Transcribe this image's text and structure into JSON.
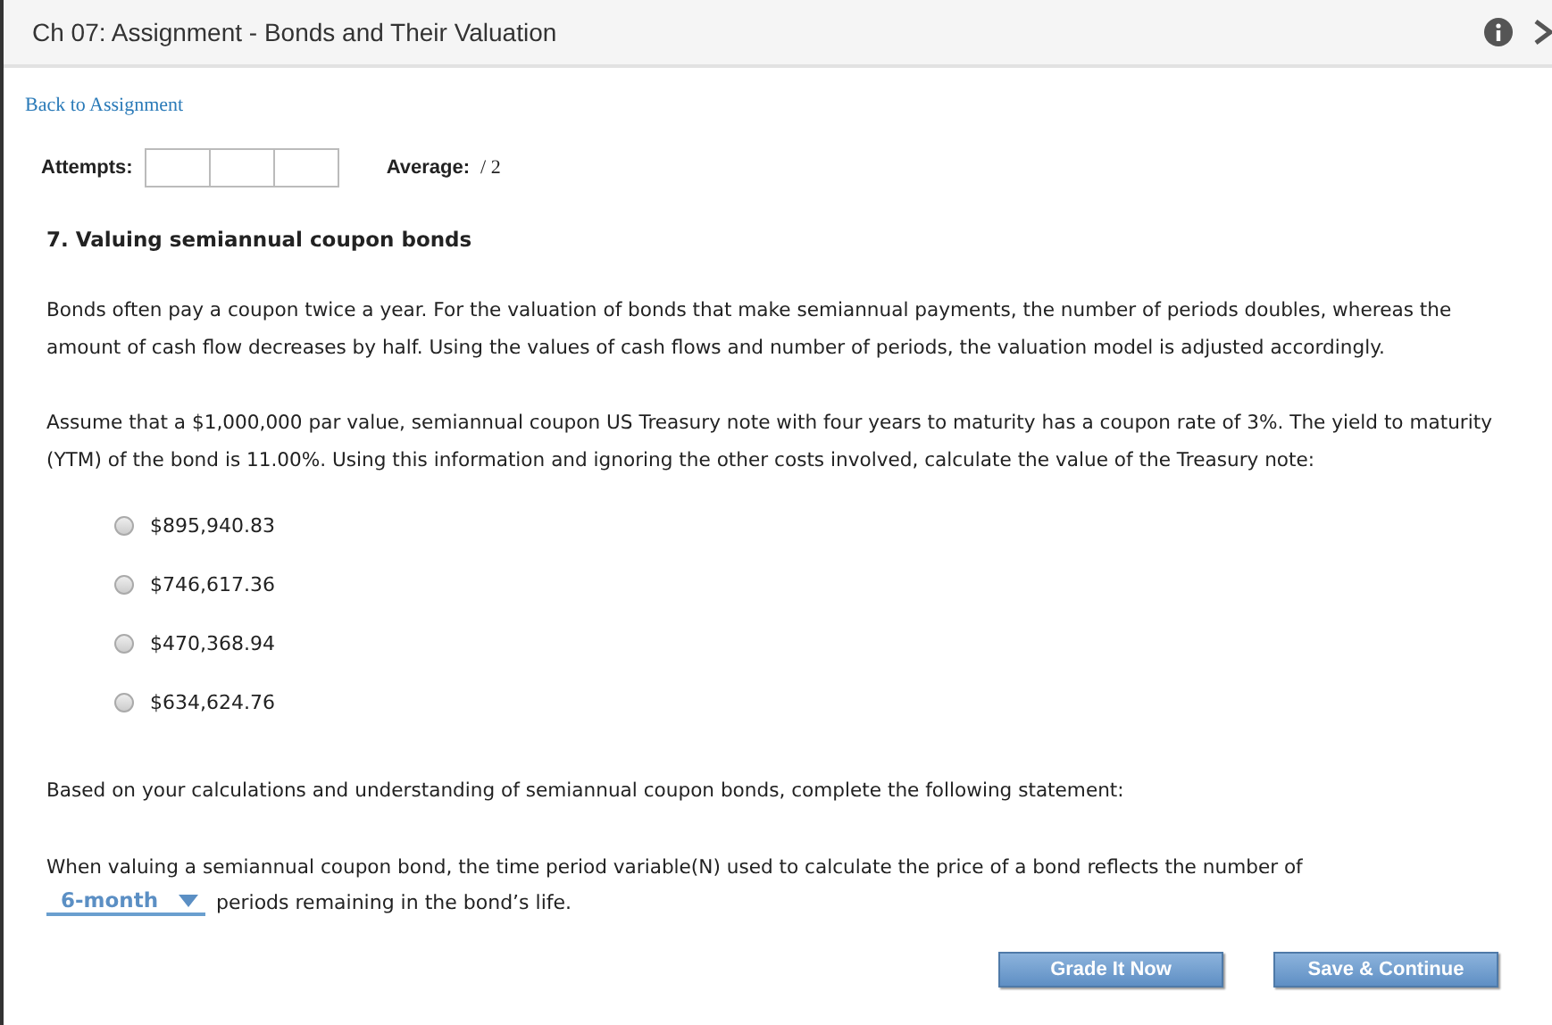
{
  "window": {
    "title": "Ch 07: Assignment - Bonds and Their Valuation"
  },
  "back_link": "Back to Assignment",
  "attempts": {
    "label": "Attempts:"
  },
  "average": {
    "label": "Average:",
    "value": "/ 2"
  },
  "question": {
    "title": "7. Valuing semiannual coupon bonds",
    "paragraphs": [
      "Bonds often pay a coupon twice a year. For the valuation of bonds that make semiannual payments, the number of periods doubles, whereas the amount of cash flow decreases by half. Using the values of cash flows and number of periods, the valuation model is adjusted accordingly.",
      "Assume that a $1,000,000 par value, semiannual coupon US Treasury note with four years to maturity has a coupon rate of 3%. The yield to maturity (YTM) of the bond is 11.00%. Using this information and ignoring the other costs involved, calculate the value of the Treasury note:"
    ],
    "options": [
      {
        "label": "$895,940.83",
        "selected": false
      },
      {
        "label": "$746,617.36",
        "selected": false
      },
      {
        "label": "$470,368.94",
        "selected": false
      },
      {
        "label": "$634,624.76",
        "selected": false
      }
    ],
    "prompt": "Based on your calculations and understanding of semiannual coupon bonds, complete the following statement:",
    "statement_before": "When valuing a semiannual coupon bond, the time period variable(N) used to calculate the price of a bond reflects the number of",
    "dropdown": {
      "value": "6-month"
    },
    "statement_after": "periods remaining in the bond’s life."
  },
  "buttons": [
    "Grade It Now",
    "Save & Continue"
  ]
}
